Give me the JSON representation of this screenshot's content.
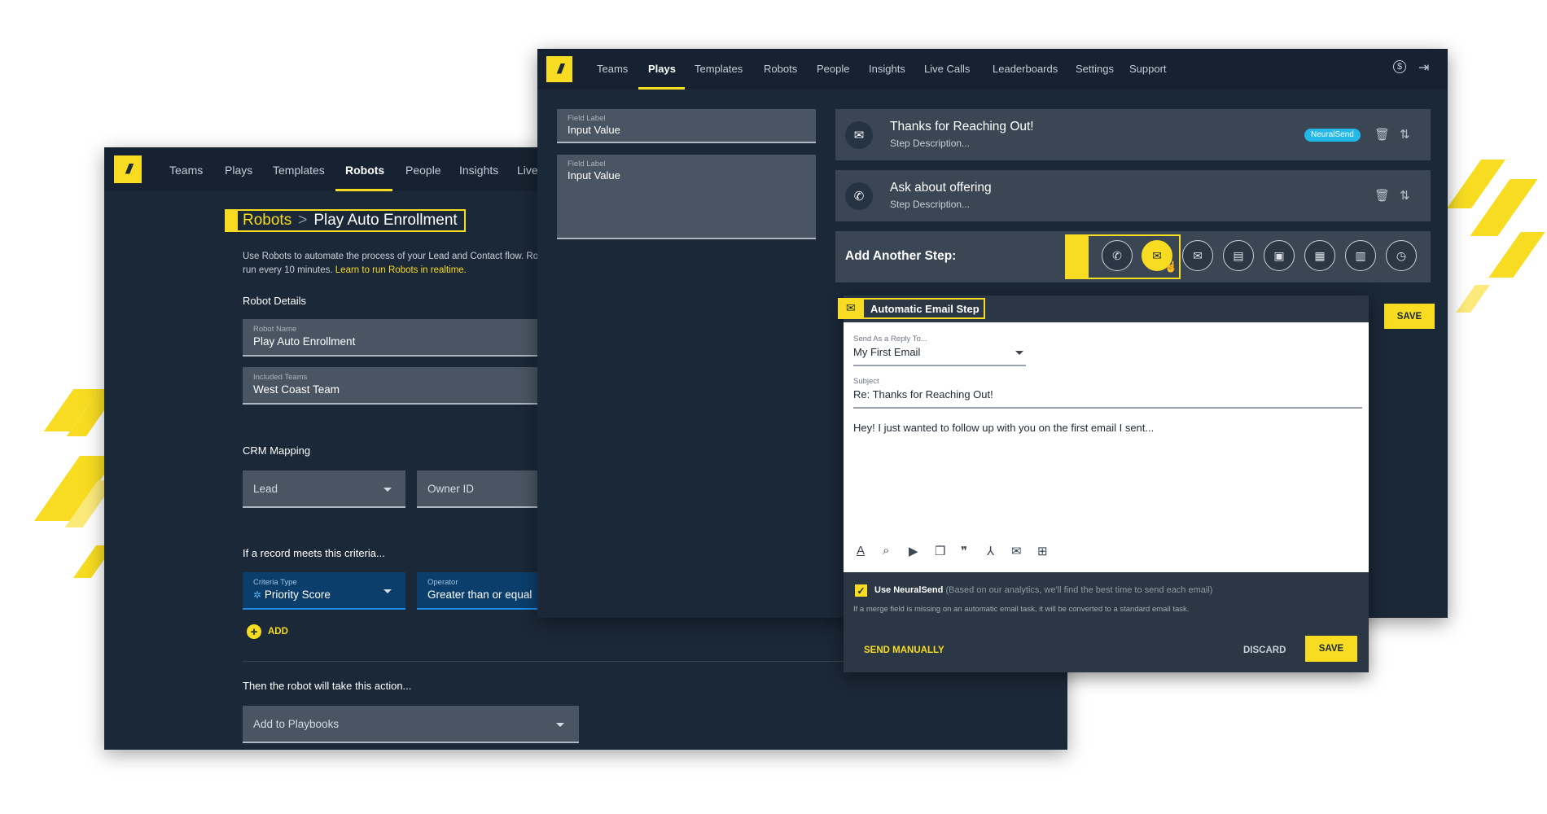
{
  "colors": {
    "accent": "#f7dc21",
    "bg": "#1b2838",
    "badge": "#22b8e8"
  },
  "back_window": {
    "nav": [
      "Teams",
      "Plays",
      "Templates",
      "Robots",
      "People",
      "Insights",
      "Live"
    ],
    "breadcrumb": {
      "parent": "Robots",
      "separator": ">",
      "current": "Play Auto Enrollment"
    },
    "intro_line1": "Use Robots to automate the process of your Lead and Contact flow. Ro",
    "intro_line2_prefix": "run every 10 minutes. ",
    "intro_link": "Learn to run Robots in realtime.",
    "robot_details_heading": "Robot Details",
    "robot_name": {
      "label": "Robot Name",
      "value": "Play Auto Enrollment"
    },
    "included_teams": {
      "label": "Included Teams",
      "value": "West Coast Team"
    },
    "crm_heading": "CRM Mapping",
    "crm_object": "Lead",
    "owner_id": "Owner ID",
    "criteria_heading": "If a record meets this criteria...",
    "criteria_type": {
      "label": "Criteria Type",
      "value": "Priority Score"
    },
    "operator": {
      "label": "Operator",
      "value": "Greater than or equal"
    },
    "add_label": "ADD",
    "action_heading": "Then the robot will take this action...",
    "action_value": "Add to Playbooks"
  },
  "front_window": {
    "nav": [
      "Teams",
      "Plays",
      "Templates",
      "Robots",
      "People",
      "Insights",
      "Live Calls",
      "Leaderboards",
      "Settings",
      "Support"
    ],
    "active_nav": "Plays",
    "field1": {
      "label": "Field Label",
      "value": "Input Value"
    },
    "field2": {
      "label": "Field Label",
      "value": "Input Value"
    },
    "steps": [
      {
        "title": "Thanks for Reaching Out!",
        "desc": "Step Description...",
        "badge": "NeuralSend",
        "icon": "email-icon"
      },
      {
        "title": "Ask about offering",
        "desc": "Step Description...",
        "icon": "phone-icon"
      }
    ],
    "add_step_label": "Add Another Step:",
    "step_buttons": [
      "phone-icon",
      "email-icon",
      "auto-email-icon",
      "sms-icon",
      "task-icon",
      "linkedin-icon",
      "note-icon",
      "wait-icon"
    ],
    "side_save": "SAVE",
    "email_panel": {
      "title": "Automatic Email Step",
      "reply_to_label": "Send As a Reply To...",
      "reply_to_value": "My First Email",
      "subject_label": "Subject",
      "subject_value": "Re: Thanks for Reaching Out!",
      "body": "Hey! I just wanted to follow up with you on the first email I sent...",
      "neuralsend_label": "Use NeuralSend",
      "neuralsend_hint": "(Based on our analytics, we'll find the best time to send each email)",
      "merge_note": "If a merge field is missing on an automatic email task, it will be converted to a standard email task.",
      "send_manually": "SEND MANUALLY",
      "discard": "DISCARD",
      "save": "SAVE"
    }
  }
}
